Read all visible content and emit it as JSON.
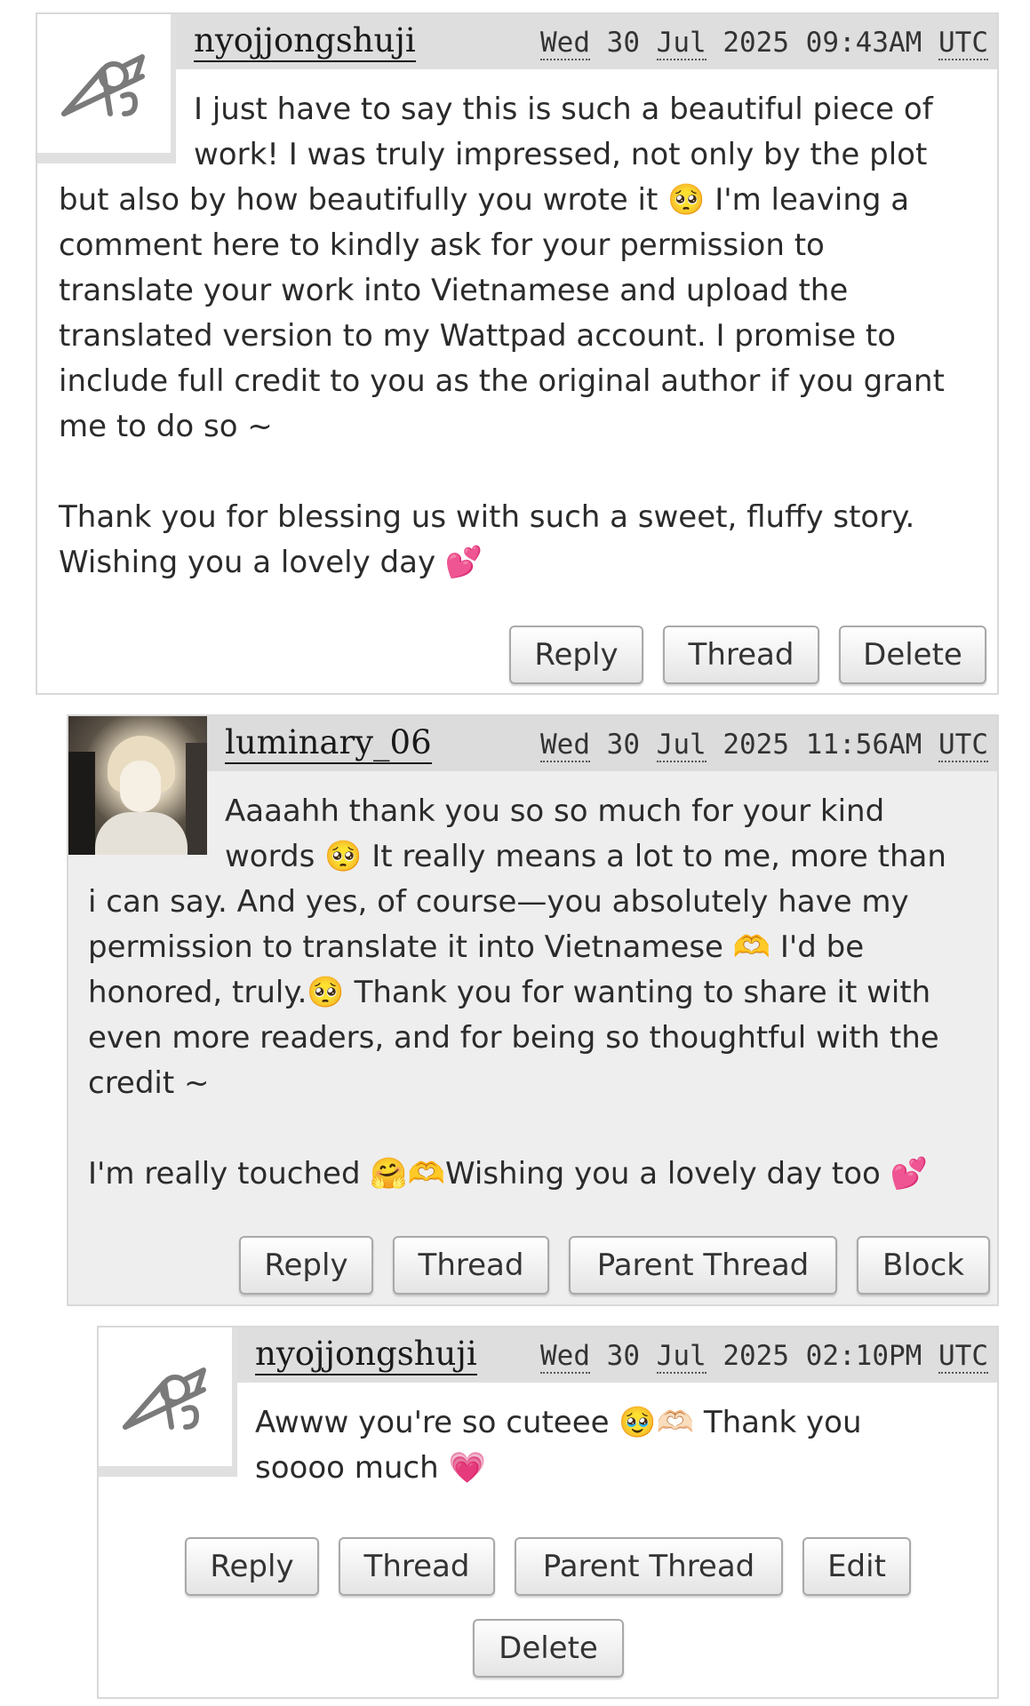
{
  "comments": [
    {
      "username": "nyojjongshuji",
      "date_day": "Wed",
      "date_num": "30",
      "date_month": "Jul",
      "date_year": "2025",
      "date_time": "09:43AM",
      "date_tz": "UTC",
      "body_p1": "I just have to say this is such a beautiful piece of work! I was truly impressed, not only by the plot",
      "body_p2": "but also by how beautifully you wrote it 🥺 I'm leaving a\ncomment here to kindly ask for your permission to\ntranslate your work into Vietnamese and upload the\ntranslated version to my Wattpad account. I promise to\ninclude full credit to you as the original author if you grant\nme to do so ~\n\nThank you for blessing us with such a sweet, fluffy story.\nWishing you a lovely day 💕",
      "buttons": [
        "Reply",
        "Thread",
        "Delete"
      ]
    },
    {
      "username": "luminary_06",
      "date_day": "Wed",
      "date_num": "30",
      "date_month": "Jul",
      "date_year": "2025",
      "date_time": "11:56AM",
      "date_tz": "UTC",
      "body_p1": "Aaaahh thank you so so much for your kind\nwords 🥺 It really means a lot to me, more than",
      "body_p2": "i can say. And yes, of course—you absolutely have my\npermission to translate it into Vietnamese 🫶 I'd be\nhonored, truly.🥺 Thank you for wanting to share it with\neven more readers, and for being so thoughtful with the\ncredit ~\n\nI'm really touched 🤗🫶Wishing you a lovely day too 💕",
      "buttons": [
        "Reply",
        "Thread",
        "Parent Thread",
        "Block"
      ]
    },
    {
      "username": "nyojjongshuji",
      "date_day": "Wed",
      "date_num": "30",
      "date_month": "Jul",
      "date_year": "2025",
      "date_time": "02:10PM",
      "date_tz": "UTC",
      "body_p1": "Awww you're so cuteee 🥹🫶🏻 Thank you\nsoooo much 💗",
      "buttons": [
        "Reply",
        "Thread",
        "Parent Thread",
        "Edit",
        "Delete"
      ]
    }
  ],
  "icons": {
    "default_avatar": "default-avatar-icon"
  },
  "colors": {
    "header_bg": "#dedede",
    "shaded_bg": "#eeeeee",
    "border": "#d9d9d9"
  }
}
